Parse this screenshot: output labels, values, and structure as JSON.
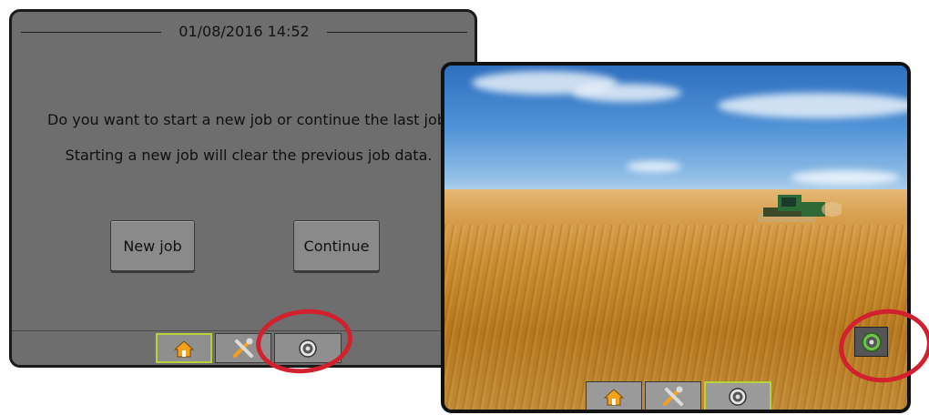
{
  "dialog": {
    "datetime": "01/08/2016 14:52",
    "message_line1": "Do you want to start a new job or continue the last job",
    "message_line2": "Starting a new job will clear the previous job data.",
    "new_job_label": "New job",
    "continue_label": "Continue"
  },
  "nav_tabs": {
    "home": "home-icon",
    "tools": "tools-icon",
    "camera": "camera-icon"
  },
  "camera_view": {
    "overlay_button": "camera-icon"
  },
  "colors": {
    "highlight_ring": "#d2202e",
    "active_tab_border": "#b8d23a",
    "dialog_bg": "#6e6e6e"
  }
}
